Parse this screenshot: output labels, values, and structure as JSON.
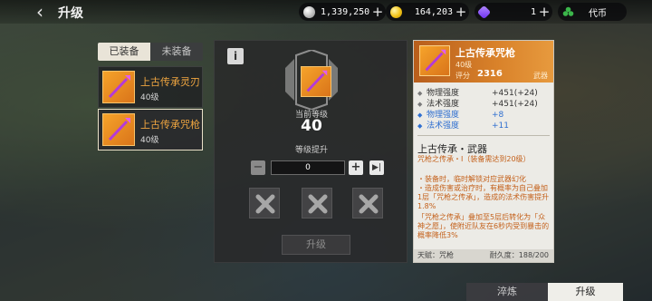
{
  "header": {
    "title": "升级"
  },
  "currencies": [
    {
      "icon": "silver-coin-icon",
      "value": "1,339,250",
      "color": "#c7c7c7"
    },
    {
      "icon": "gold-coin-icon",
      "value": "164,203",
      "color": "#f2c318"
    },
    {
      "icon": "purple-gem-icon",
      "value": "1",
      "color": "#7b4cff"
    },
    {
      "icon": "clover-icon",
      "value": "代币",
      "color": "#3bb54a"
    }
  ],
  "tabs": {
    "equipped": "已装备",
    "unequipped": "未装备"
  },
  "equipment": [
    {
      "name": "上古传承灵刃",
      "level": "40级"
    },
    {
      "name": "上古传承咒枪",
      "level": "40级"
    }
  ],
  "upgrade": {
    "current_level_label": "当前等级",
    "current_level": "40",
    "level_up_label": "等级提升",
    "amount": "0",
    "minus": "−",
    "plus": "+",
    "max": "▶|",
    "button": "升级"
  },
  "card": {
    "name": "上古传承咒枪",
    "level": "40级",
    "score_label": "评分",
    "score": "2316",
    "type": "武器",
    "stats": [
      {
        "name": "物理强度",
        "value": "+451(+24)"
      },
      {
        "name": "法术强度",
        "value": "+451(+24)"
      },
      {
        "name": "物理强度",
        "value": "+8"
      },
      {
        "name": "法术强度",
        "value": "+11"
      }
    ],
    "section_title": "上古传承・武器",
    "set_line": "咒枪之传承・I（装备需达到20级）",
    "desc_lines": [
      "・装备时，临时解锁对应武器幻化",
      "・造成伤害或治疗时，有概率为自己叠加1层「咒枪之传承」，造成的法术伤害提升1.8%",
      "「咒枪之传承」叠加至5层后转化为「众神之愿」，使附近队友在6秒内受到暴击的概率降低3%"
    ],
    "footer_left": "天赋：咒枪",
    "footer_right": "耐久度：188/200"
  },
  "bottom_tabs": {
    "refine": "淬炼",
    "upgrade": "升级"
  }
}
